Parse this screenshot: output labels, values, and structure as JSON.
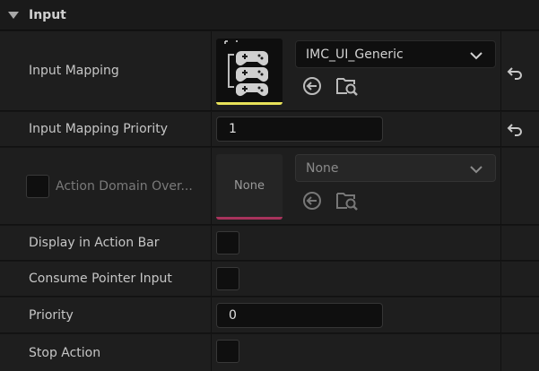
{
  "section": {
    "title": "Input"
  },
  "rows": {
    "input_mapping": {
      "label": "Input Mapping",
      "selected_value": "IMC_UI_Generic",
      "accent": "#e8e25a"
    },
    "input_mapping_priority": {
      "label": "Input Mapping Priority",
      "value": "1"
    },
    "action_domain": {
      "label": "Action Domain Over...",
      "thumb_text": "None",
      "selected_value": "None",
      "accent": "#a8335c"
    },
    "display_in_action_bar": {
      "label": "Display in Action Bar"
    },
    "consume_pointer_input": {
      "label": "Consume Pointer Input"
    },
    "priority": {
      "label": "Priority",
      "value": "0"
    },
    "stop_action": {
      "label": "Stop Action"
    }
  },
  "icons": {
    "collapse": "triangle-down-icon",
    "reset": "reset-arrow-icon",
    "use_selected": "use-selected-arrow-icon",
    "browse": "browse-folder-icon",
    "gamepad": "gamepad-stack-icon",
    "chevron": "chevron-down-icon"
  }
}
